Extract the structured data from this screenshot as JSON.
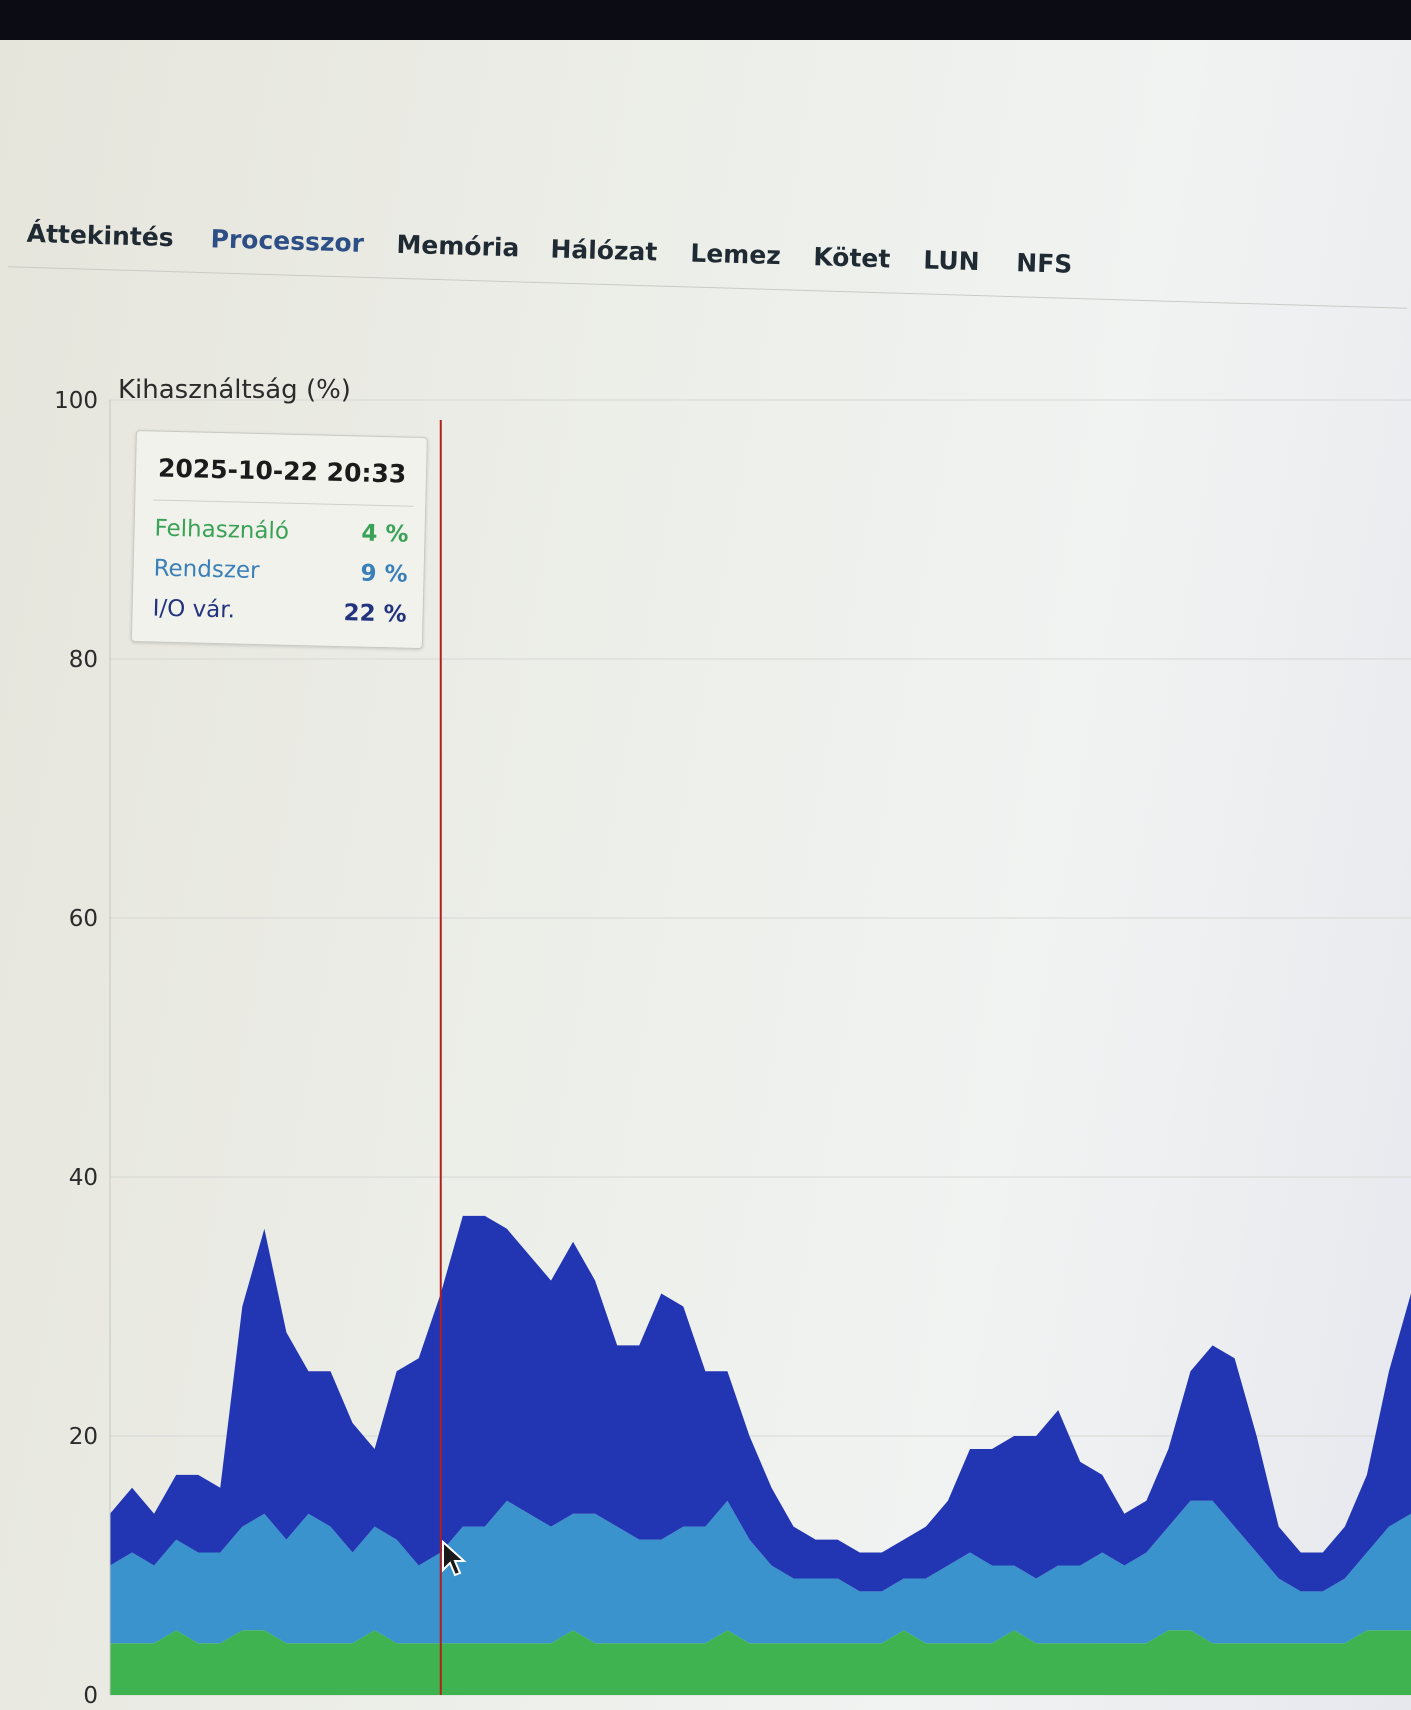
{
  "tabs": [
    {
      "label": "Áttekintés",
      "active": false
    },
    {
      "label": "Processzor",
      "active": true
    },
    {
      "label": "Memória",
      "active": false
    },
    {
      "label": "Hálózat",
      "active": false
    },
    {
      "label": "Lemez",
      "active": false
    },
    {
      "label": "Kötet",
      "active": false
    },
    {
      "label": "LUN",
      "active": false
    },
    {
      "label": "NFS",
      "active": false
    }
  ],
  "tooltip": {
    "time": "2025-10-22 20:33",
    "rows": [
      {
        "name": "Felhasználó",
        "value": "4 %",
        "color": "#3aa257"
      },
      {
        "name": "Rendszer",
        "value": "9 %",
        "color": "#3b7fb8"
      },
      {
        "name": "I/O vár.",
        "value": "22 %",
        "color": "#24337e"
      }
    ]
  },
  "colors": {
    "user": "#3fb34f",
    "system": "#3a93cc",
    "iowait": "#2236b4",
    "crosshair": "#b3201c",
    "active_tab": "#2d4f86"
  },
  "chart_data": {
    "type": "area",
    "stacked": true,
    "ylabel": "Kihasználtság (%)",
    "ylim": [
      0,
      100
    ],
    "yticks": [
      0,
      20,
      40,
      60,
      80,
      100
    ],
    "grid": true,
    "x": [
      0,
      1,
      2,
      3,
      4,
      5,
      6,
      7,
      8,
      9,
      10,
      11,
      12,
      13,
      14,
      15,
      16,
      17,
      18,
      19,
      20,
      21,
      22,
      23,
      24,
      25,
      26,
      27,
      28,
      29,
      30,
      31,
      32,
      33,
      34,
      35,
      36,
      37,
      38,
      39,
      40,
      41,
      42,
      43,
      44,
      45,
      46,
      47,
      48,
      49,
      50,
      51,
      52,
      53,
      54,
      55,
      56,
      57,
      58,
      59
    ],
    "series": [
      {
        "name": "Felhasználó",
        "values": [
          4,
          4,
          4,
          5,
          4,
          4,
          5,
          5,
          4,
          4,
          4,
          4,
          5,
          4,
          4,
          4,
          4,
          4,
          4,
          4,
          4,
          5,
          4,
          4,
          4,
          4,
          4,
          4,
          5,
          4,
          4,
          4,
          4,
          4,
          4,
          4,
          5,
          4,
          4,
          4,
          4,
          5,
          4,
          4,
          4,
          4,
          4,
          4,
          5,
          5,
          4,
          4,
          4,
          4,
          4,
          4,
          4,
          5,
          5,
          5
        ]
      },
      {
        "name": "Rendszer",
        "values": [
          6,
          7,
          6,
          7,
          7,
          7,
          8,
          9,
          8,
          10,
          9,
          7,
          8,
          8,
          6,
          7,
          9,
          9,
          11,
          10,
          9,
          9,
          10,
          9,
          8,
          8,
          9,
          9,
          10,
          8,
          6,
          5,
          5,
          5,
          4,
          4,
          4,
          5,
          6,
          7,
          6,
          5,
          5,
          6,
          6,
          7,
          6,
          7,
          8,
          10,
          11,
          9,
          7,
          5,
          4,
          4,
          5,
          6,
          8,
          9
        ]
      },
      {
        "name": "I/O vár.",
        "values": [
          4,
          5,
          4,
          5,
          6,
          5,
          17,
          22,
          16,
          11,
          12,
          10,
          6,
          13,
          16,
          20,
          24,
          24,
          21,
          20,
          19,
          21,
          18,
          14,
          15,
          19,
          17,
          12,
          10,
          8,
          6,
          4,
          3,
          3,
          3,
          3,
          3,
          4,
          5,
          8,
          9,
          10,
          11,
          12,
          8,
          6,
          4,
          4,
          6,
          10,
          12,
          13,
          9,
          4,
          3,
          3,
          4,
          6,
          12,
          17
        ]
      }
    ],
    "crosshair_index": 15
  }
}
